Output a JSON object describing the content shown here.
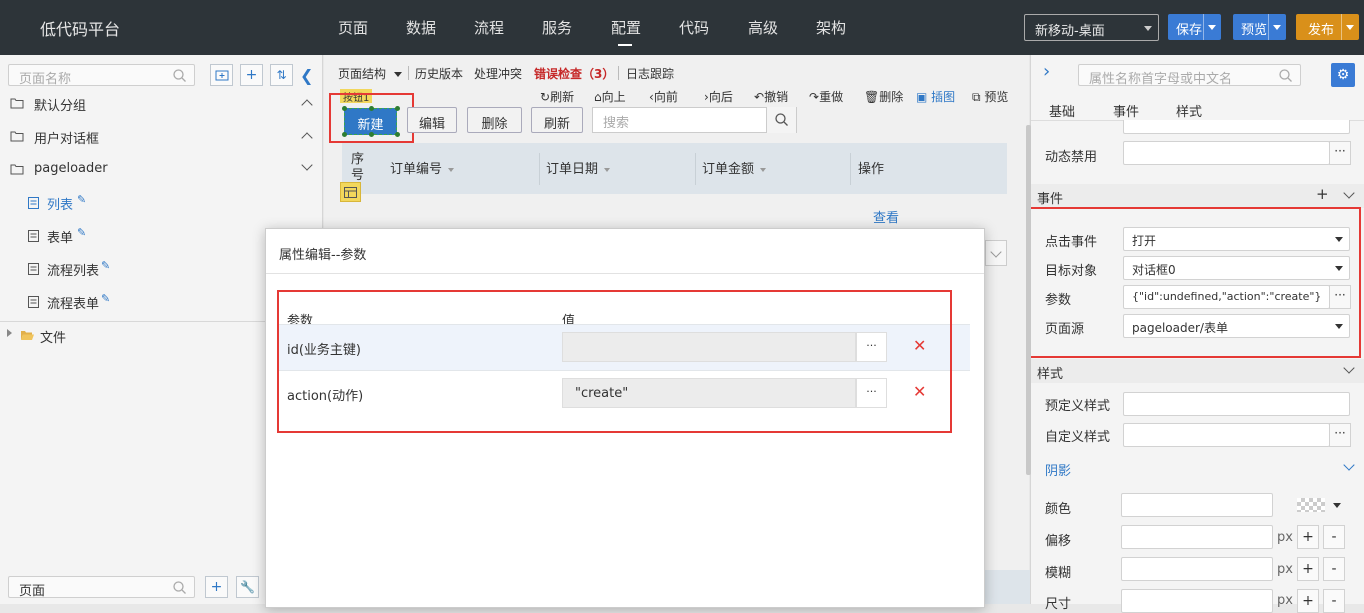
{
  "app": {
    "title": "低代码平台"
  },
  "nav": {
    "items": [
      "页面",
      "数据",
      "流程",
      "服务",
      "配置",
      "代码",
      "高级",
      "架构"
    ],
    "active": "配置"
  },
  "device": {
    "value": "新移动-桌面"
  },
  "actions": {
    "save": "保存",
    "preview": "预览",
    "publish": "发布"
  },
  "colors": {
    "save": "#3a7bd5",
    "preview": "#3a7bd5",
    "publish": "#d9901a",
    "accent": "#2f78c6",
    "error": "#c62828",
    "delete": "#e53935"
  },
  "left": {
    "search_placeholder": "页面名称",
    "tree": {
      "group_default": "默认分组",
      "group_dialog": "用户对话框",
      "group_pageloader": "pageloader",
      "item_list": "列表",
      "item_form": "表单",
      "item_flow_list": "流程列表",
      "item_flow_form": "流程表单",
      "folder_files": "文件"
    },
    "bottom_input": "页面"
  },
  "middle": {
    "toolbar": {
      "structure": "页面结构",
      "history": "历史版本",
      "conflict": "处理冲突",
      "errors": "错误检查（3）",
      "log": "日志跟踪"
    },
    "icons": {
      "refresh": "刷新",
      "up": "向上",
      "prev": "向前",
      "next": "向后",
      "undo": "撤销",
      "redo": "重做",
      "delete": "删除",
      "snapshot": "插图",
      "preview": "预览"
    },
    "component_tag": "按钮1",
    "buttons": {
      "new": "新建",
      "edit": "编辑",
      "delete": "删除",
      "refresh": "刷新"
    },
    "search_placeholder": "搜索",
    "table": {
      "col_seq": "序号",
      "col_order_no": "订单编号",
      "col_order_date": "订单日期",
      "col_amount": "订单金额",
      "col_ops": "操作"
    },
    "row_action": "查看"
  },
  "dialog": {
    "title": "属性编辑--参数",
    "col_param": "参数",
    "col_value": "值",
    "rows": [
      {
        "param": "id(业务主键)",
        "value": ""
      },
      {
        "param": "action(动作)",
        "value": "\"create\""
      }
    ],
    "ellipsis": "···",
    "delete_icon": "✕"
  },
  "right": {
    "search_placeholder": "属性名称首字母或中文名",
    "tabs": [
      "基础",
      "事件",
      "样式"
    ],
    "dynamic_disable": "动态禁用",
    "events_section": "事件",
    "click_event_label": "点击事件",
    "click_event_value": "打开",
    "target_label": "目标对象",
    "target_value": "对话框0",
    "params_label": "参数",
    "params_value": "{\"id\":undefined,\"action\":\"create\"}",
    "page_source_label": "页面源",
    "page_source_value": "pageloader/表单",
    "style_section": "样式",
    "predefined_label": "预定义样式",
    "custom_label": "自定义样式",
    "shadow_section": "阴影",
    "color_label": "颜色",
    "offset_label": "偏移",
    "blur_label": "模糊",
    "size_label": "尺寸",
    "unit": "px",
    "plus": "+",
    "minus": "-"
  }
}
